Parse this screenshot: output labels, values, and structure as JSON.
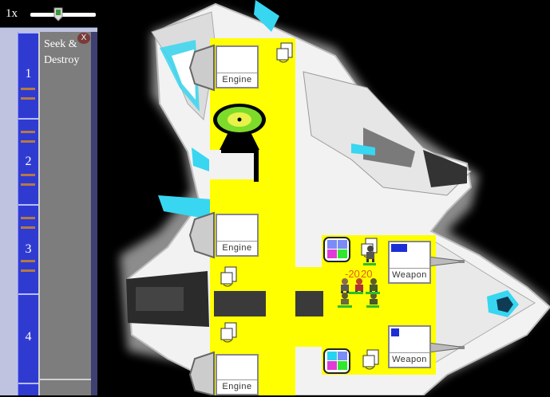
{
  "speed": {
    "label": "1x",
    "value_fraction": 0.43
  },
  "timeline": {
    "segments": [
      "1",
      "2",
      "3",
      "4"
    ]
  },
  "task": {
    "text": "Seek & Destroy",
    "close": "X"
  },
  "systems": {
    "engine_top": "Engine",
    "engine_mid": "Engine",
    "engine_bottom": "Engine",
    "weapon_top": "Weapon",
    "weapon_bottom": "Weapon"
  },
  "damage_numbers": [
    "-20",
    "20"
  ],
  "colors": {
    "room": "#ffff00",
    "timeline": "#2f3bd0",
    "hull_accent": "#38d6f0"
  },
  "icons": [
    "engine-system",
    "door-control",
    "sensor-dish",
    "shield-grid",
    "crew-figure"
  ]
}
